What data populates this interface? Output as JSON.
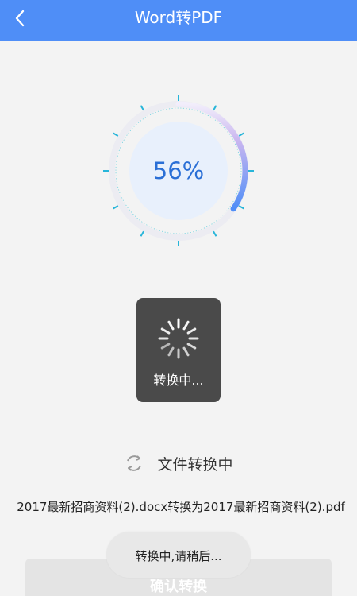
{
  "header": {
    "title": "Word转PDF",
    "back_icon": "chevron-left-icon"
  },
  "progress": {
    "percent_text": "56%",
    "value": 0.56,
    "colors": {
      "arc_start": "#4f8ef7",
      "arc_end": "#c9b6f0",
      "tick": "#27b5d9",
      "inner": "#e8f0fc",
      "percent_text": "#2a6fd6"
    }
  },
  "loading_toast": {
    "label": "转换中..."
  },
  "status": {
    "icon": "refresh-icon",
    "label": "文件转换中"
  },
  "file_description": "2017最新招商资料(2).docx转换为2017最新招商资料(2).pdf",
  "confirm_button": {
    "label": "确认转换"
  },
  "toast": {
    "label": "转换中,请稍后..."
  }
}
